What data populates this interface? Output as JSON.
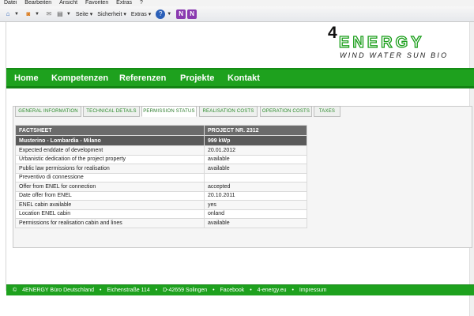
{
  "browser": {
    "menu": [
      "Datei",
      "Bearbeiten",
      "Ansicht",
      "Favoriten",
      "Extras",
      "?"
    ],
    "toolbar": {
      "page_label": "Seite",
      "security_label": "Sicherheit",
      "tools_label": "Extras"
    }
  },
  "logo": {
    "number": "4",
    "word": "ENERGY",
    "tagline": "WIND WATER SUN BIO"
  },
  "nav": {
    "items": [
      "Home",
      "Kompetenzen",
      "Referenzen",
      "Projekte",
      "Kontakt"
    ]
  },
  "tabs": {
    "items": [
      "GENERAL INFORMATION",
      "TECHNICAL DETAILS",
      "PERMISSION STATUS",
      "REALISATION COSTS",
      "OPERATION COSTS",
      "TAXES"
    ],
    "active": "PERMISSION STATUS"
  },
  "factsheet": {
    "header": [
      "FACTSHEET",
      "PROJECT NR. 2312"
    ],
    "subheader": [
      "Musterino - Lombardia - Milano",
      "999 kWp"
    ],
    "rows": [
      [
        "Expected enddate of development",
        "20.01.2012"
      ],
      [
        "Urbanistic dedication of the project property",
        "available"
      ],
      [
        "Public law permissions for realisation",
        "available"
      ],
      [
        "Preventivo di connessione",
        ""
      ],
      [
        "Offer from ENEL for connection",
        "accepted"
      ],
      [
        "Date offer from ENEL",
        "20.10.2011"
      ],
      [
        "ENEL cabin available",
        "yes"
      ],
      [
        "Location ENEL cabin",
        "onland"
      ],
      [
        "Permissions for realisation cabin and lines",
        "available"
      ]
    ]
  },
  "footer": {
    "parts": [
      "©",
      "4ENERGY Büro Deutschland",
      "•",
      "Eichenstraße 114",
      "•",
      "D-42659 Solingen",
      "•",
      "Facebook",
      "•",
      "4-energy.eu",
      "•",
      "Impressum"
    ]
  },
  "colors": {
    "brand_green": "#1ea11e",
    "header_gray": "#6b6b6b",
    "tab_text": "#2a8a2a"
  }
}
